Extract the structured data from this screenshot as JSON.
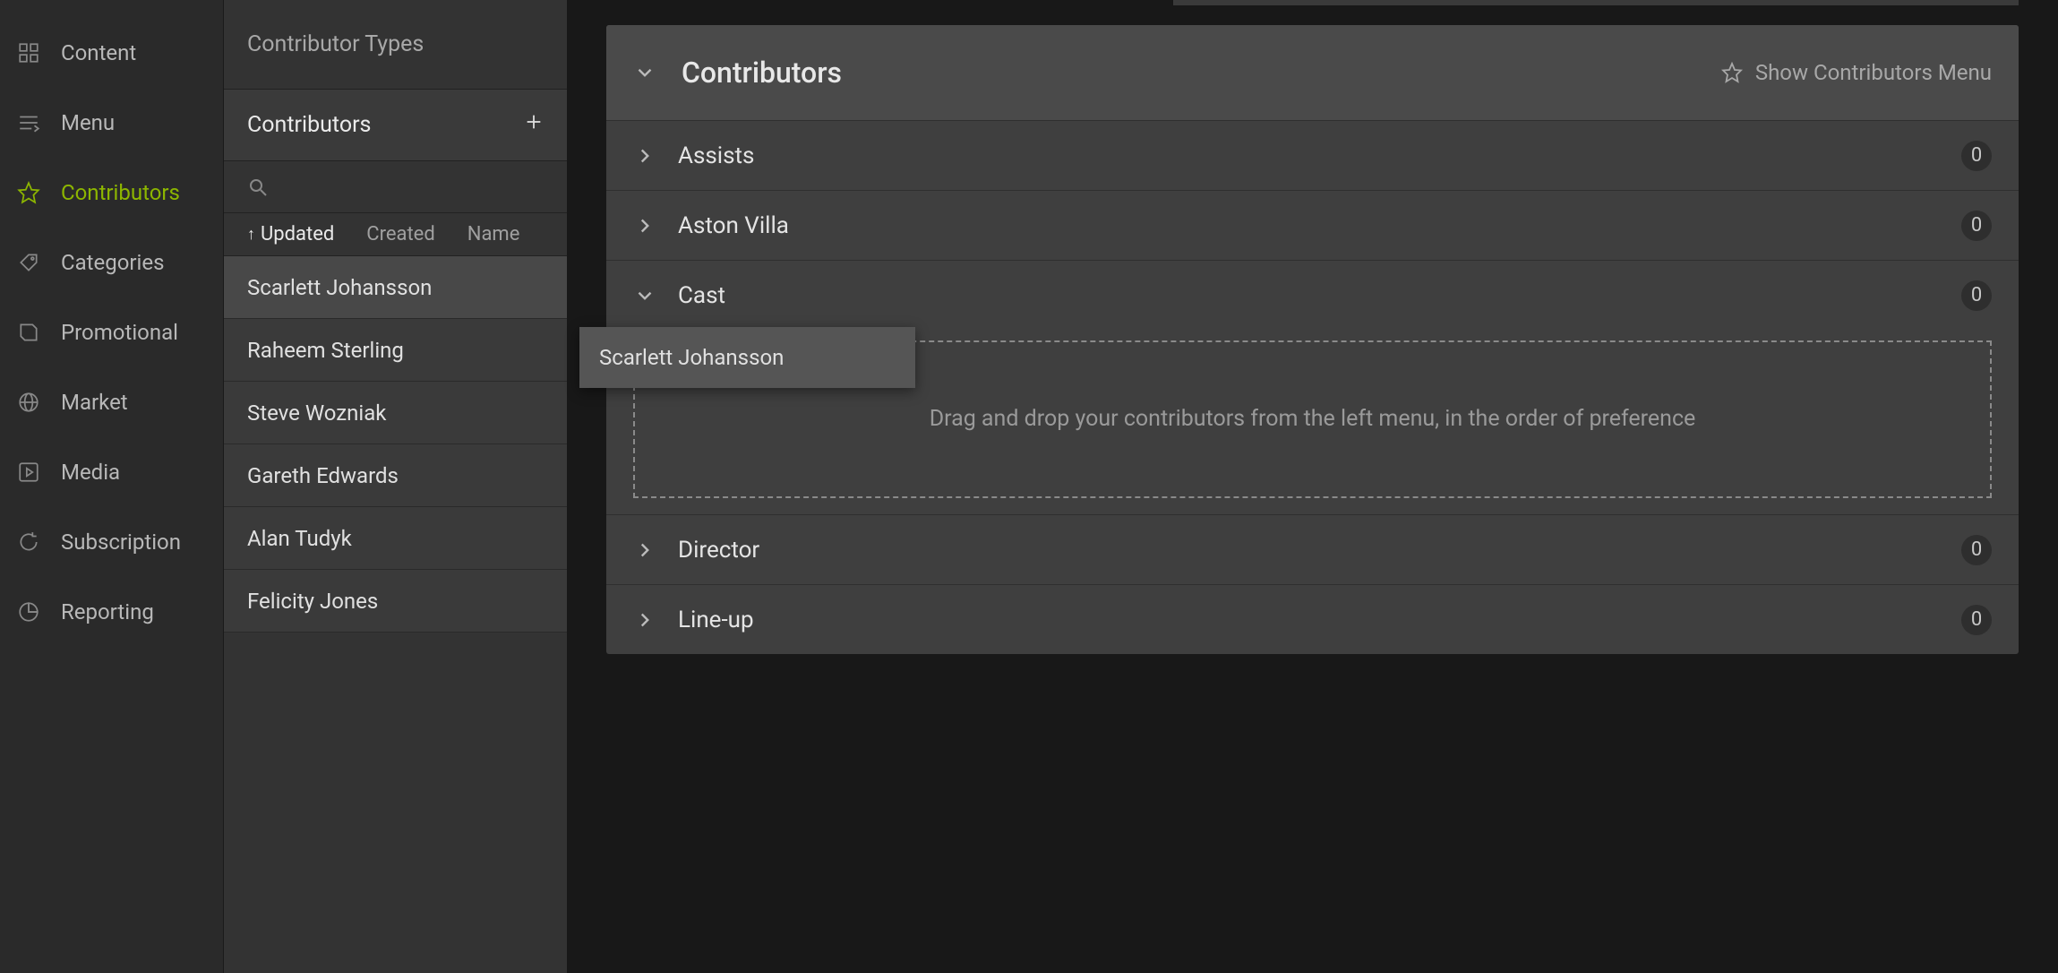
{
  "sidebar": {
    "items": [
      {
        "label": "Content"
      },
      {
        "label": "Menu"
      },
      {
        "label": "Contributors"
      },
      {
        "label": "Categories"
      },
      {
        "label": "Promotional"
      },
      {
        "label": "Market"
      },
      {
        "label": "Media"
      },
      {
        "label": "Subscription"
      },
      {
        "label": "Reporting"
      }
    ]
  },
  "panel": {
    "title": "Contributor Types",
    "section": "Contributors",
    "sort": {
      "updated": "Updated",
      "created": "Created",
      "name": "Name"
    },
    "people": [
      "Scarlett Johansson",
      "Raheem Sterling",
      "Steve Wozniak",
      "Gareth Edwards",
      "Alan Tudyk",
      "Felicity Jones"
    ]
  },
  "main": {
    "title": "Contributors",
    "showMenu": "Show Contributors Menu",
    "dropText": "Drag and drop your contributors from the left menu, in the order of preference",
    "groups": [
      {
        "name": "Assists",
        "count": "0",
        "expanded": false
      },
      {
        "name": "Aston Villa",
        "count": "0",
        "expanded": false
      },
      {
        "name": "Cast",
        "count": "0",
        "expanded": true
      },
      {
        "name": "Director",
        "count": "0",
        "expanded": false
      },
      {
        "name": "Line-up",
        "count": "0",
        "expanded": false
      }
    ]
  },
  "drag": {
    "name": "Scarlett Johansson"
  }
}
